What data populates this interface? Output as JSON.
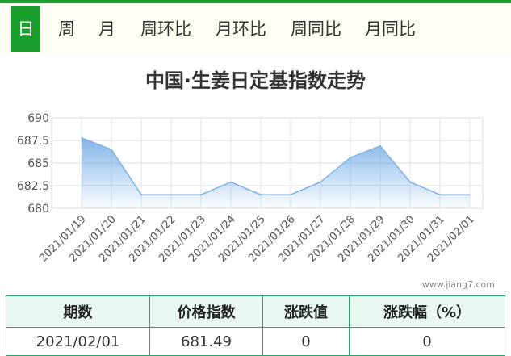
{
  "tabs": [
    {
      "label": "日",
      "active": true
    },
    {
      "label": "周",
      "active": false
    },
    {
      "label": "月",
      "active": false
    },
    {
      "label": "周环比",
      "active": false
    },
    {
      "label": "月环比",
      "active": false
    },
    {
      "label": "周同比",
      "active": false
    },
    {
      "label": "月同比",
      "active": false
    }
  ],
  "watermark": "www.jiang7.com",
  "table": {
    "headers": [
      "期数",
      "价格指数",
      "涨跌值",
      "涨跌幅（%）"
    ],
    "row": [
      "2021/02/01",
      "681.49",
      "0",
      "0"
    ]
  },
  "colors": {
    "accent": "#1a9e2e",
    "line": "#7db3e6",
    "fill_top": "#5b9de0",
    "table_border": "#2aa56b"
  },
  "chart_data": {
    "type": "area",
    "title": "中国·生姜日定基指数走势",
    "xlabel": "",
    "ylabel": "",
    "ylim": [
      680,
      690
    ],
    "yticks": [
      "690",
      "687.5",
      "685",
      "682.5",
      "680"
    ],
    "grid": true,
    "categories": [
      "2021/01/19",
      "2021/01/20",
      "2021/01/21",
      "2021/01/22",
      "2021/01/23",
      "2021/01/24",
      "2021/01/25",
      "2021/01/26",
      "2021/01/27",
      "2021/01/28",
      "2021/01/29",
      "2021/01/30",
      "2021/01/31",
      "2021/02/01"
    ],
    "series": [
      {
        "values": [
          687.8,
          686.5,
          681.5,
          681.5,
          681.5,
          682.9,
          681.5,
          681.5,
          682.9,
          685.6,
          686.9,
          682.9,
          681.5,
          681.5
        ]
      }
    ]
  }
}
